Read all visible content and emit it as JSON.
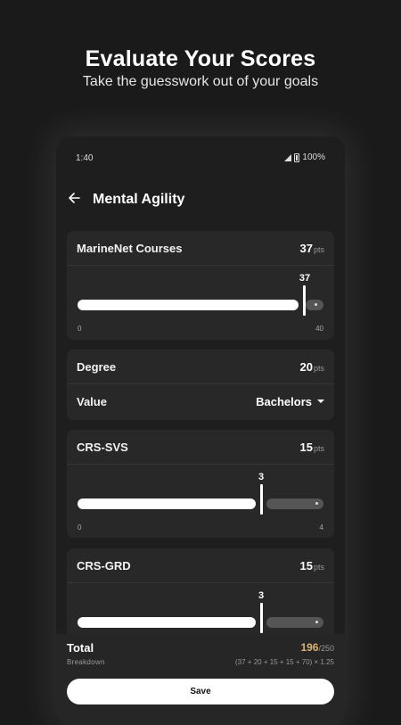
{
  "hero": {
    "title": "Evaluate Your Scores",
    "subtitle": "Take the guesswork out of your goals"
  },
  "status_bar": {
    "time": "1:40",
    "battery": "100%"
  },
  "screen": {
    "title": "Mental Agility",
    "back_icon": "arrow-left-icon"
  },
  "cards": {
    "marinenet": {
      "label": "MarineNet Courses",
      "points": "37",
      "unit": "pts",
      "slider_value": "37",
      "min": "0",
      "max": "40",
      "fraction": 0.925
    },
    "degree": {
      "label": "Degree",
      "points": "20",
      "unit": "pts",
      "value_label": "Value",
      "value": "Bachelors"
    },
    "crs_svs": {
      "label": "CRS-SVS",
      "points": "15",
      "unit": "pts",
      "slider_value": "3",
      "min": "0",
      "max": "4",
      "fraction": 0.75
    },
    "crs_grd": {
      "label": "CRS-GRD",
      "points": "15",
      "unit": "pts",
      "slider_value": "3",
      "fraction": 0.75
    }
  },
  "footer": {
    "total_label": "Total",
    "breakdown_label": "Breakdown",
    "score": "196",
    "max": "/250",
    "formula": "(37 + 20 + 15 + 15 + 70) × 1.25",
    "save_label": "Save"
  },
  "colors": {
    "background": "#1a1a1a",
    "card": "#282828",
    "accent_score": "#e0b270"
  }
}
